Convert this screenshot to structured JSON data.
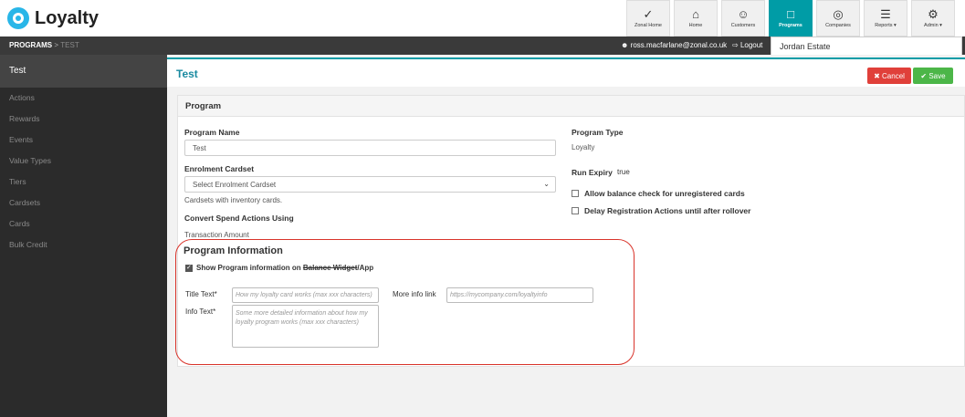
{
  "app": {
    "title": "Loyalty"
  },
  "nav": [
    {
      "icon": "zonal-home-icon",
      "glyph": "✓",
      "label": "Zonal Home"
    },
    {
      "icon": "home-icon",
      "glyph": "⌂",
      "label": "Home"
    },
    {
      "icon": "customers-icon",
      "glyph": "☺",
      "label": "Customers"
    },
    {
      "icon": "programs-icon",
      "glyph": "□",
      "label": "Programs"
    },
    {
      "icon": "companies-icon",
      "glyph": "◎",
      "label": "Companies"
    },
    {
      "icon": "reports-icon",
      "glyph": "☰",
      "label": "Reports ▾"
    },
    {
      "icon": "admin-icon",
      "glyph": "⚙",
      "label": "Admin ▾"
    }
  ],
  "breadcrumb": {
    "root": "PROGRAMS",
    "sep": ">",
    "current": "TEST"
  },
  "header": {
    "user": "ross.macfarlane@zonal.co.uk",
    "logout": "Logout",
    "estate": "Jordan Estate"
  },
  "sidebar": {
    "title": "Test",
    "items": [
      "Actions",
      "Rewards",
      "Events",
      "Value Types",
      "Tiers",
      "Cardsets",
      "Cards",
      "Bulk Credit"
    ]
  },
  "page": {
    "title": "Test",
    "cancel": "Cancel",
    "save": "Save"
  },
  "program": {
    "panel_title": "Program",
    "name_label": "Program Name",
    "name_value": "Test",
    "cardset_label": "Enrolment Cardset",
    "cardset_value": "Select Enrolment Cardset",
    "cardset_help": "Cardsets with inventory cards.",
    "convert_label": "Convert Spend Actions Using",
    "convert_value": "Transaction Amount",
    "type_label": "Program Type",
    "type_value": "Loyalty",
    "expiry_label": "Run Expiry",
    "expiry_value": "true",
    "balance_check_label": "Allow balance check for unregistered cards",
    "delay_label": "Delay Registration Actions until after rollover"
  },
  "info": {
    "title": "Program Information",
    "show_prefix": "Show Program information on ",
    "show_strike": "Balance Widget",
    "show_suffix": "/App",
    "title_text_label": "Title Text*",
    "title_text_placeholder": "How my loyalty card works (max xxx characters)",
    "info_text_label": "Info Text*",
    "info_text_placeholder": "Some more detailed information about how my loyalty program works (max xxx characters)",
    "more_info_label": "More info link",
    "more_info_placeholder": "https://mycompany.com/loyaltyinfo"
  },
  "colors": {
    "accent": "#009ca6",
    "cancel": "#e0403a",
    "save": "#4cb648",
    "highlight": "#d9342b"
  }
}
